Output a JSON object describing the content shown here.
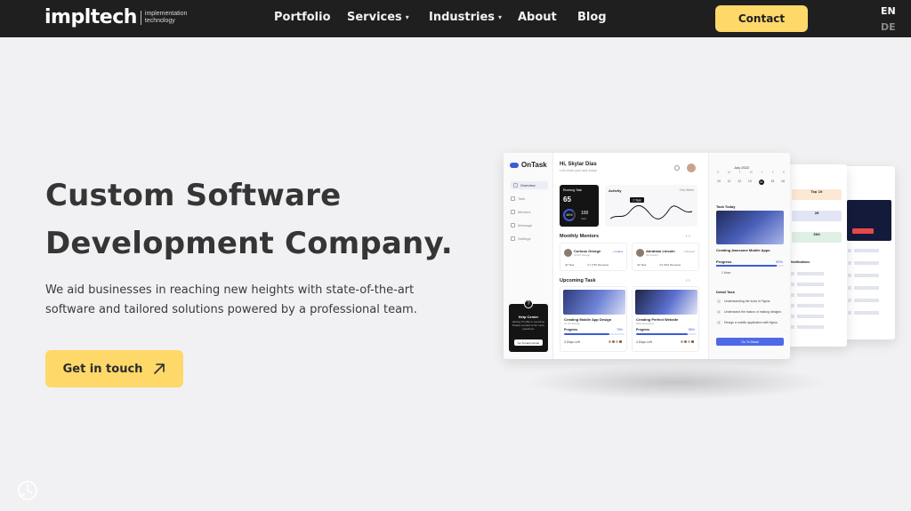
{
  "nav": {
    "logo": "impltech",
    "logo_sub_1": "implementation",
    "logo_sub_2": "technology",
    "links": [
      "Portfolio",
      "Services",
      "Industries",
      "About",
      "Blog"
    ],
    "contact": "Contact",
    "lang_active": "EN",
    "lang_other": "DE"
  },
  "hero": {
    "title_line1": "Custom Software",
    "title_line2": "Development Company.",
    "subtitle": "We aid businesses in reaching new heights with state-of-the-art software and tailored solutions powered by a professional team.",
    "cta": "Get in touch"
  },
  "mockup": {
    "app": "OnTask",
    "greeting": "Hi, Skylar Dias",
    "greeting_sub": "Let's finish your task today!",
    "sidebar": [
      "Overview",
      "Task",
      "Mentors",
      "Message",
      "Settings"
    ],
    "help": {
      "title": "Help Center",
      "desc": "Having Trouble in Learning. Please contact us for more questions.",
      "button": "Go To Help Center"
    },
    "running": {
      "label": "Running Task",
      "value": "65",
      "percent": "45%",
      "total": "100",
      "unit": "Task"
    },
    "activity": {
      "label": "Activity",
      "range": "This Week",
      "tooltip": "2 Task"
    },
    "mentors_title": "Monthly Mentors",
    "mentors": [
      {
        "name": "Curious George",
        "role": "UI/UX Design",
        "action": "+ Follow",
        "tasks": "40 Task",
        "rating": "4,7 (750 Reviews)"
      },
      {
        "name": "Abraham Lincoln",
        "role": "3D Design",
        "action": "Followed",
        "tasks": "32 Task",
        "rating": "4,9 (510 Reviews)"
      }
    ],
    "upcoming_title": "Upcoming Task",
    "tasks": [
      {
        "name": "Creating Mobile App Design",
        "role": "UI UX Design",
        "progress_label": "Progress",
        "progress": "75%",
        "progress_value": 0.75,
        "time": "3 Days Left"
      },
      {
        "name": "Creating Perfect Website",
        "role": "Web Developer",
        "progress_label": "Progress",
        "progress": "85%",
        "progress_value": 0.85,
        "time": "4 Days Left"
      }
    ],
    "calendar": {
      "month": "July 2022",
      "days": [
        "S",
        "M",
        "T",
        "W",
        "T",
        "F",
        "S"
      ],
      "dates": [
        "10",
        "11",
        "12",
        "13",
        "14",
        "15",
        "16"
      ],
      "selected": "14"
    },
    "today": {
      "title": "Task Today",
      "name": "Creating Awesome Mobile Apps",
      "progress_label": "Progress",
      "progress": "90%",
      "progress_value": 0.9,
      "time": "1 Hour"
    },
    "detail": {
      "title": "Detail Task",
      "steps": [
        "Understanding the tools in Figma",
        "Understand the basics of making designs",
        "Design a mobile application with figma"
      ],
      "button": "Go To Detail"
    },
    "card_b": {
      "top_title": "Top 10",
      "top_value": "26",
      "top_value2": "500",
      "notifications": "Notifications"
    }
  }
}
